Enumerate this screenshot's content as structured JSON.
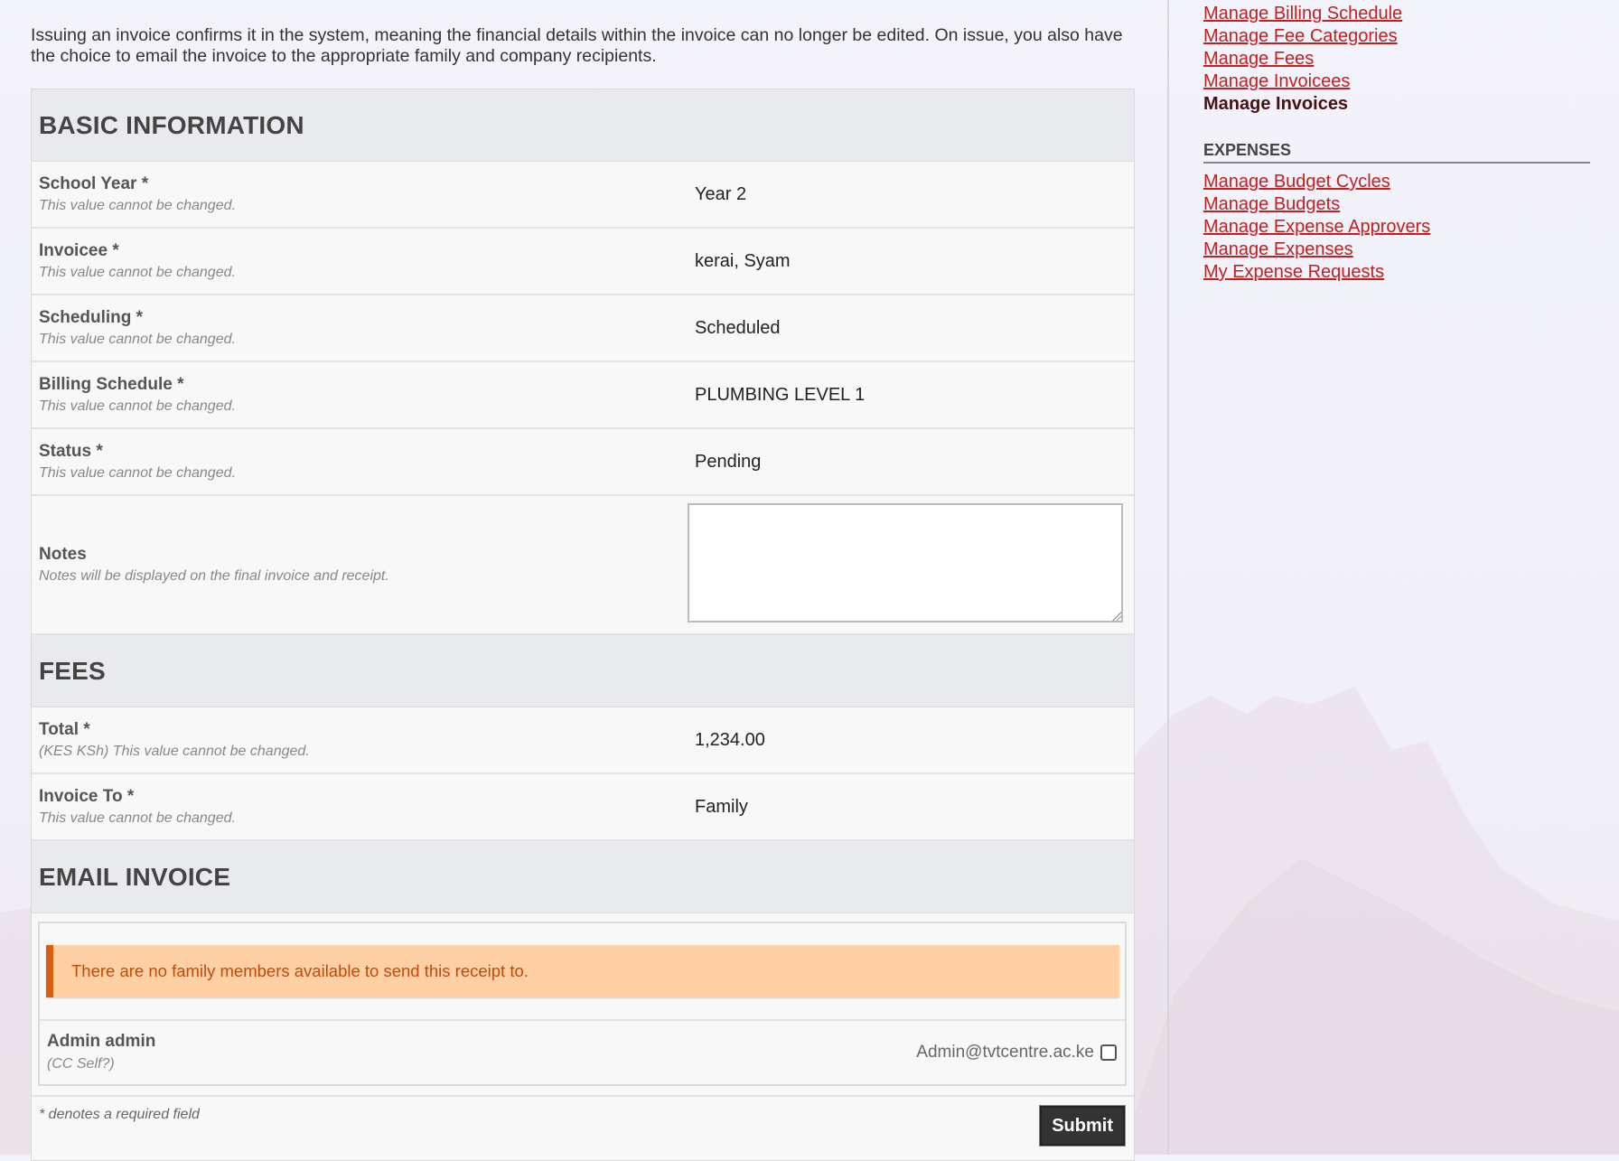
{
  "intro": "Issuing an invoice confirms it in the system, meaning the financial details within the invoice can no longer be edited. On issue, you also have the choice to email the invoice to the appropriate family and company recipients.",
  "sections": {
    "basic": "BASIC INFORMATION",
    "fees": "FEES",
    "email": "EMAIL INVOICE"
  },
  "fields": {
    "school_year": {
      "label": "School Year *",
      "desc": "This value cannot be changed.",
      "value": "Year 2"
    },
    "invoicee": {
      "label": "Invoicee *",
      "desc": "This value cannot be changed.",
      "value": "kerai, Syam"
    },
    "scheduling": {
      "label": "Scheduling *",
      "desc": "This value cannot be changed.",
      "value": "Scheduled"
    },
    "billing_schedule": {
      "label": "Billing Schedule *",
      "desc": "This value cannot be changed.",
      "value": "PLUMBING LEVEL 1"
    },
    "status": {
      "label": "Status *",
      "desc": "This value cannot be changed.",
      "value": "Pending"
    },
    "notes": {
      "label": "Notes",
      "desc": "Notes will be displayed on the final invoice and receipt.",
      "value": ""
    },
    "total": {
      "label": "Total *",
      "desc": "(KES KSh) This value cannot be changed.",
      "value": "1,234.00"
    },
    "invoice_to": {
      "label": "Invoice To *",
      "desc": "This value cannot be changed.",
      "value": "Family"
    }
  },
  "email": {
    "warning": "There are no family members available to send this receipt to.",
    "recipient_name": "Admin admin",
    "recipient_cc": "(CC Self?)",
    "recipient_email": "Admin@tvtcentre.ac.ke"
  },
  "footer": {
    "required_note": "* denotes a required field",
    "submit_label": "Submit"
  },
  "sidebar": {
    "billing_links": [
      "Manage Billing Schedule",
      "Manage Fee Categories",
      "Manage Fees",
      "Manage Invoicees"
    ],
    "current": "Manage Invoices",
    "expenses_heading": "EXPENSES",
    "expense_links": [
      "Manage Budget Cycles",
      "Manage Budgets",
      "Manage Expense Approvers",
      "Manage Expenses",
      "My Expense Requests"
    ]
  },
  "colors": {
    "link": "#c41e1e",
    "warning_bg": "#ffd0a4",
    "warning_border": "#d95f12"
  }
}
